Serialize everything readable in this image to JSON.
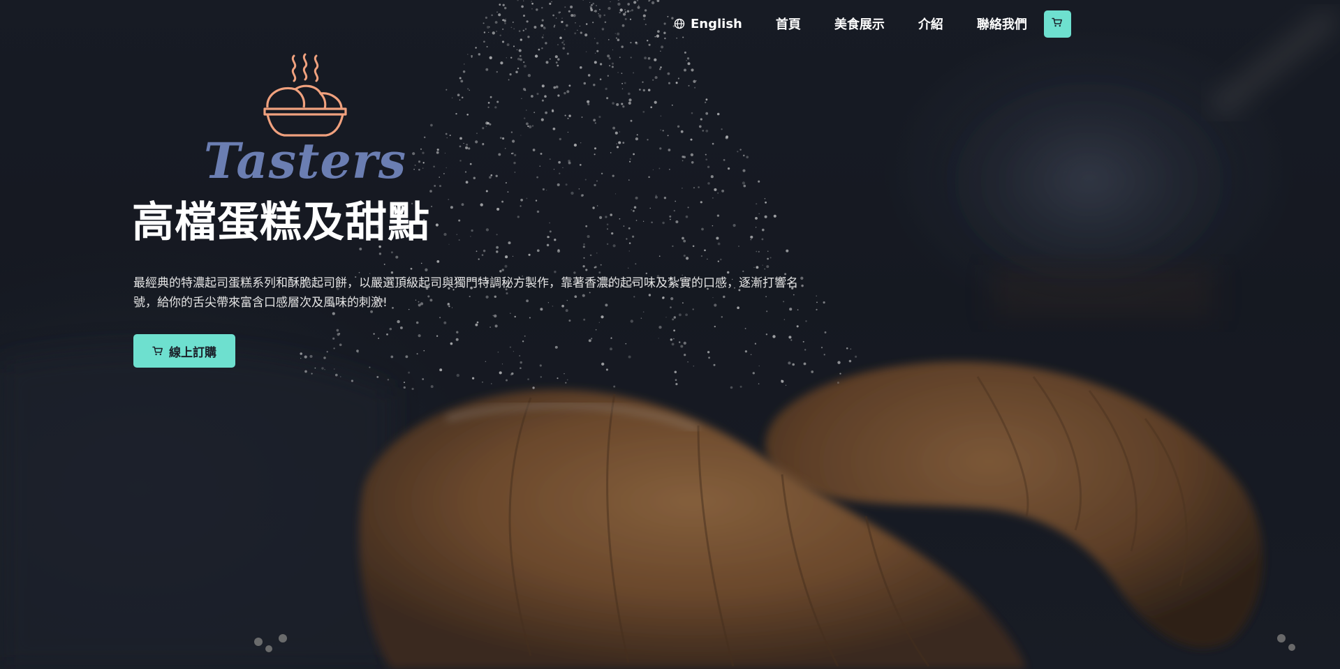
{
  "nav": {
    "language_label": "English",
    "links": [
      {
        "label": "首頁"
      },
      {
        "label": "美食展示"
      },
      {
        "label": "介紹"
      },
      {
        "label": "聯絡我們"
      }
    ]
  },
  "brand": {
    "name": "Tasters",
    "logo_icon": "bread-basket-steam-icon"
  },
  "hero": {
    "headline": "高檔蛋糕及甜點",
    "description": "最經典的特濃起司蛋糕系列和酥脆起司餅，以嚴選頂級起司與獨門特調秘方製作，靠著香濃的起司味及紮實的口感，逐漸打響名號，給你的舌尖帶來富含口感層次及風味的刺激!",
    "cta_label": "線上訂購"
  },
  "icons": {
    "language": "globe-icon",
    "cart": "cart-icon"
  },
  "colors": {
    "accent": "#6ee0cf",
    "logo_peach": "#f0a17e",
    "logo_blue": "#6b7eb2",
    "background": "#181c25"
  }
}
